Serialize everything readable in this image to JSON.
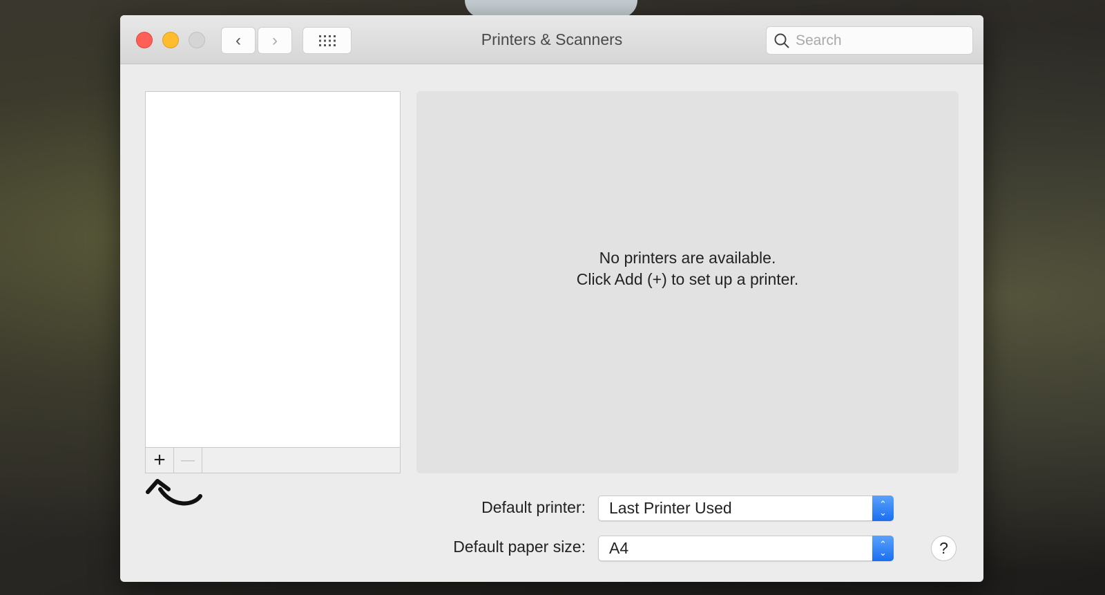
{
  "window": {
    "title": "Printers & Scanners"
  },
  "toolbar": {
    "back_icon": "chevron-left-icon",
    "forward_icon": "chevron-right-icon",
    "grid_icon": "grid-icon"
  },
  "search": {
    "placeholder": "Search"
  },
  "printer_list": {
    "add_label": "+",
    "remove_label": "—"
  },
  "panel": {
    "line1": "No printers are available.",
    "line2": "Click Add (+) to set up a printer."
  },
  "settings": {
    "default_printer_label": "Default printer:",
    "default_printer_value": "Last Printer Used",
    "paper_size_label": "Default paper size:",
    "paper_size_value": "A4"
  },
  "help": {
    "label": "?"
  },
  "colors": {
    "close": "#fe5f57",
    "minimize": "#febc2e",
    "zoom_disabled": "#d5d5d5",
    "accent": "#1a6ff0"
  }
}
